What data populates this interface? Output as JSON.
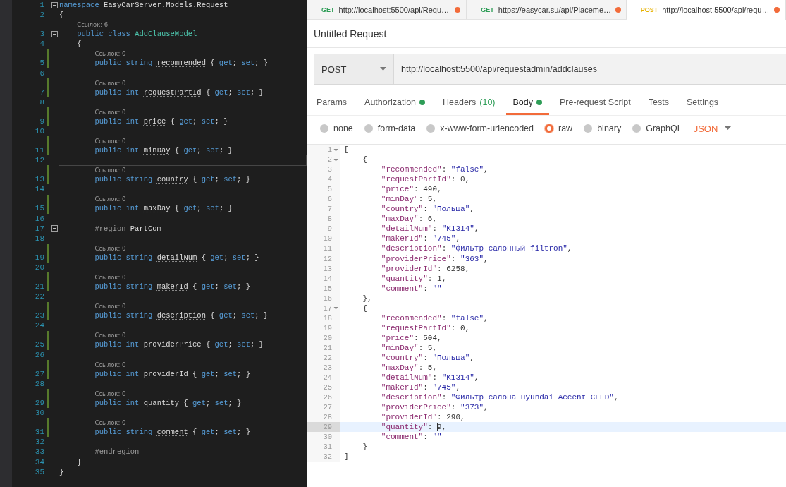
{
  "code_editor": {
    "lines": [
      {
        "num": "1",
        "fold": true,
        "changed": false,
        "current": false,
        "tokens": [
          {
            "kind": "kw",
            "text": "namespace"
          },
          {
            "kind": "text",
            "text": " EasyCarServer.Models.Request"
          }
        ]
      },
      {
        "num": "2",
        "fold": false,
        "changed": false,
        "current": false,
        "tokens": [
          {
            "kind": "text",
            "text": "{"
          }
        ]
      },
      {
        "num": "3",
        "lens": "Ссылок: 6",
        "fold": true,
        "changed": false,
        "current": false,
        "tokens": [
          {
            "kind": "kw",
            "text": "    public class "
          },
          {
            "kind": "type",
            "text": "AddClauseModel"
          }
        ]
      },
      {
        "num": "4",
        "fold": false,
        "changed": false,
        "current": false,
        "tokens": [
          {
            "kind": "text",
            "text": "    {"
          }
        ]
      },
      {
        "num": "5",
        "lens": "Ссылок: 0",
        "fold": false,
        "changed": true,
        "current": false,
        "tokens": [
          {
            "kind": "kw",
            "text": "        public string "
          },
          {
            "kind": "member",
            "text": "recommended"
          },
          {
            "kind": "text",
            "text": " { "
          },
          {
            "kind": "kw",
            "text": "get"
          },
          {
            "kind": "text",
            "text": "; "
          },
          {
            "kind": "kw",
            "text": "set"
          },
          {
            "kind": "text",
            "text": "; }"
          }
        ]
      },
      {
        "num": "6",
        "fold": false,
        "changed": false,
        "current": false
      },
      {
        "num": "7",
        "lens": "Ссылок: 0",
        "fold": false,
        "changed": true,
        "current": false,
        "tokens": [
          {
            "kind": "kw",
            "text": "        public int "
          },
          {
            "kind": "member",
            "text": "requestPartId"
          },
          {
            "kind": "text",
            "text": " { "
          },
          {
            "kind": "kw",
            "text": "get"
          },
          {
            "kind": "text",
            "text": "; "
          },
          {
            "kind": "kw",
            "text": "set"
          },
          {
            "kind": "text",
            "text": "; }"
          }
        ]
      },
      {
        "num": "8",
        "fold": false,
        "changed": false,
        "current": false
      },
      {
        "num": "9",
        "lens": "Ссылок: 0",
        "fold": false,
        "changed": true,
        "current": false,
        "tokens": [
          {
            "kind": "kw",
            "text": "        public int "
          },
          {
            "kind": "member",
            "text": "price"
          },
          {
            "kind": "text",
            "text": " { "
          },
          {
            "kind": "kw",
            "text": "get"
          },
          {
            "kind": "text",
            "text": "; "
          },
          {
            "kind": "kw",
            "text": "set"
          },
          {
            "kind": "text",
            "text": "; }"
          }
        ]
      },
      {
        "num": "10",
        "fold": false,
        "changed": false,
        "current": false
      },
      {
        "num": "11",
        "lens": "Ссылок: 0",
        "fold": false,
        "changed": true,
        "current": false,
        "tokens": [
          {
            "kind": "kw",
            "text": "        public int "
          },
          {
            "kind": "member",
            "text": "minDay"
          },
          {
            "kind": "text",
            "text": " { "
          },
          {
            "kind": "kw",
            "text": "get"
          },
          {
            "kind": "text",
            "text": "; "
          },
          {
            "kind": "kw",
            "text": "set"
          },
          {
            "kind": "text",
            "text": "; }"
          }
        ]
      },
      {
        "num": "12",
        "fold": false,
        "changed": false,
        "current": true
      },
      {
        "num": "13",
        "lens": "Ссылок: 0",
        "fold": false,
        "changed": true,
        "current": false,
        "tokens": [
          {
            "kind": "kw",
            "text": "        public string "
          },
          {
            "kind": "member",
            "text": "country"
          },
          {
            "kind": "text",
            "text": " { "
          },
          {
            "kind": "kw",
            "text": "get"
          },
          {
            "kind": "text",
            "text": "; "
          },
          {
            "kind": "kw",
            "text": "set"
          },
          {
            "kind": "text",
            "text": "; }"
          }
        ]
      },
      {
        "num": "14",
        "fold": false,
        "changed": false,
        "current": false
      },
      {
        "num": "15",
        "lens": "Ссылок: 0",
        "fold": false,
        "changed": true,
        "current": false,
        "tokens": [
          {
            "kind": "kw",
            "text": "        public int "
          },
          {
            "kind": "member",
            "text": "maxDay"
          },
          {
            "kind": "text",
            "text": " { "
          },
          {
            "kind": "kw",
            "text": "get"
          },
          {
            "kind": "text",
            "text": "; "
          },
          {
            "kind": "kw",
            "text": "set"
          },
          {
            "kind": "text",
            "text": "; }"
          }
        ]
      },
      {
        "num": "16",
        "fold": false,
        "changed": false,
        "current": false
      },
      {
        "num": "17",
        "fold": true,
        "changed": false,
        "current": false,
        "tokens": [
          {
            "kind": "directive",
            "text": "        #region"
          },
          {
            "kind": "text",
            "text": " PartCom"
          }
        ]
      },
      {
        "num": "18",
        "fold": false,
        "changed": false,
        "current": false
      },
      {
        "num": "19",
        "lens": "Ссылок: 0",
        "fold": false,
        "changed": true,
        "current": false,
        "tokens": [
          {
            "kind": "kw",
            "text": "        public string "
          },
          {
            "kind": "member",
            "text": "detailNum"
          },
          {
            "kind": "text",
            "text": " { "
          },
          {
            "kind": "kw",
            "text": "get"
          },
          {
            "kind": "text",
            "text": "; "
          },
          {
            "kind": "kw",
            "text": "set"
          },
          {
            "kind": "text",
            "text": "; }"
          }
        ]
      },
      {
        "num": "20",
        "fold": false,
        "changed": false,
        "current": false
      },
      {
        "num": "21",
        "lens": "Ссылок: 0",
        "fold": false,
        "changed": true,
        "current": false,
        "tokens": [
          {
            "kind": "kw",
            "text": "        public string "
          },
          {
            "kind": "member",
            "text": "makerId"
          },
          {
            "kind": "text",
            "text": " { "
          },
          {
            "kind": "kw",
            "text": "get"
          },
          {
            "kind": "text",
            "text": "; "
          },
          {
            "kind": "kw",
            "text": "set"
          },
          {
            "kind": "text",
            "text": "; }"
          }
        ]
      },
      {
        "num": "22",
        "fold": false,
        "changed": false,
        "current": false
      },
      {
        "num": "23",
        "lens": "Ссылок: 0",
        "fold": false,
        "changed": true,
        "current": false,
        "tokens": [
          {
            "kind": "kw",
            "text": "        public string "
          },
          {
            "kind": "member",
            "text": "description"
          },
          {
            "kind": "text",
            "text": " { "
          },
          {
            "kind": "kw",
            "text": "get"
          },
          {
            "kind": "text",
            "text": "; "
          },
          {
            "kind": "kw",
            "text": "set"
          },
          {
            "kind": "text",
            "text": "; }"
          }
        ]
      },
      {
        "num": "24",
        "fold": false,
        "changed": false,
        "current": false
      },
      {
        "num": "25",
        "lens": "Ссылок: 0",
        "fold": false,
        "changed": true,
        "current": false,
        "tokens": [
          {
            "kind": "kw",
            "text": "        public int "
          },
          {
            "kind": "member",
            "text": "providerPrice"
          },
          {
            "kind": "text",
            "text": " { "
          },
          {
            "kind": "kw",
            "text": "get"
          },
          {
            "kind": "text",
            "text": "; "
          },
          {
            "kind": "kw",
            "text": "set"
          },
          {
            "kind": "text",
            "text": "; }"
          }
        ]
      },
      {
        "num": "26",
        "fold": false,
        "changed": false,
        "current": false
      },
      {
        "num": "27",
        "lens": "Ссылок: 0",
        "fold": false,
        "changed": true,
        "current": false,
        "tokens": [
          {
            "kind": "kw",
            "text": "        public int "
          },
          {
            "kind": "member",
            "text": "providerId"
          },
          {
            "kind": "text",
            "text": " { "
          },
          {
            "kind": "kw",
            "text": "get"
          },
          {
            "kind": "text",
            "text": "; "
          },
          {
            "kind": "kw",
            "text": "set"
          },
          {
            "kind": "text",
            "text": "; }"
          }
        ]
      },
      {
        "num": "28",
        "fold": false,
        "changed": false,
        "current": false
      },
      {
        "num": "29",
        "lens": "Ссылок: 0",
        "fold": false,
        "changed": true,
        "current": false,
        "tokens": [
          {
            "kind": "kw",
            "text": "        public int "
          },
          {
            "kind": "member",
            "text": "quantity"
          },
          {
            "kind": "text",
            "text": " { "
          },
          {
            "kind": "kw",
            "text": "get"
          },
          {
            "kind": "text",
            "text": "; "
          },
          {
            "kind": "kw",
            "text": "set"
          },
          {
            "kind": "text",
            "text": "; }"
          }
        ]
      },
      {
        "num": "30",
        "fold": false,
        "changed": false,
        "current": false
      },
      {
        "num": "31",
        "lens": "Ссылок: 0",
        "fold": false,
        "changed": true,
        "current": false,
        "tokens": [
          {
            "kind": "kw",
            "text": "        public string "
          },
          {
            "kind": "member",
            "text": "comment"
          },
          {
            "kind": "text",
            "text": " { "
          },
          {
            "kind": "kw",
            "text": "get"
          },
          {
            "kind": "text",
            "text": "; "
          },
          {
            "kind": "kw",
            "text": "set"
          },
          {
            "kind": "text",
            "text": "; }"
          }
        ]
      },
      {
        "num": "32",
        "fold": false,
        "changed": false,
        "current": false
      },
      {
        "num": "33",
        "fold": false,
        "changed": false,
        "current": false,
        "tokens": [
          {
            "kind": "directive",
            "text": "        #endregion"
          }
        ]
      },
      {
        "num": "34",
        "fold": false,
        "changed": false,
        "current": false,
        "tokens": [
          {
            "kind": "text",
            "text": "    }"
          }
        ]
      },
      {
        "num": "35",
        "fold": false,
        "changed": false,
        "current": false,
        "tokens": [
          {
            "kind": "text",
            "text": "}"
          }
        ]
      }
    ]
  },
  "request_tabs": [
    {
      "method": "GET",
      "url": "http://localhost:5500/api/Requ…",
      "unsaved": true,
      "selected": false
    },
    {
      "method": "GET",
      "url": "https://easycar.su/api/Placeme…",
      "unsaved": true,
      "selected": false
    },
    {
      "method": "POST",
      "url": "http://localhost:5500/api/requ…",
      "unsaved": true,
      "selected": true
    }
  ],
  "request_title": "Untitled Request",
  "url_bar": {
    "method": "POST",
    "url": "http://localhost:5500/api/requestadmin/addclauses"
  },
  "section_tabs": [
    {
      "label": "Params",
      "indicator": false,
      "selected": false
    },
    {
      "label": "Authorization",
      "indicator": true,
      "selected": false
    },
    {
      "label": "Headers",
      "count": "(10)",
      "indicator": false,
      "selected": false
    },
    {
      "label": "Body",
      "indicator": true,
      "selected": true
    },
    {
      "label": "Pre-request Script",
      "indicator": false,
      "selected": false
    },
    {
      "label": "Tests",
      "indicator": false,
      "selected": false
    },
    {
      "label": "Settings",
      "indicator": false,
      "selected": false
    }
  ],
  "body_modes": [
    {
      "label": "none",
      "selected": false
    },
    {
      "label": "form-data",
      "selected": false
    },
    {
      "label": "x-www-form-urlencoded",
      "selected": false
    },
    {
      "label": "raw",
      "selected": true
    },
    {
      "label": "binary",
      "selected": false
    },
    {
      "label": "GraphQL",
      "selected": false
    }
  ],
  "body_format": "JSON",
  "body_editor": {
    "lines": [
      {
        "num": "1",
        "fold": true,
        "current": false,
        "tokens": [
          {
            "kind": "p",
            "text": "["
          }
        ]
      },
      {
        "num": "2",
        "fold": true,
        "current": false,
        "tokens": [
          {
            "kind": "p",
            "text": "    {"
          }
        ]
      },
      {
        "num": "3",
        "fold": false,
        "current": false,
        "tokens": [
          {
            "kind": "key",
            "text": "        \"recommended\""
          },
          {
            "kind": "p",
            "text": ": "
          },
          {
            "kind": "str",
            "text": "\"false\""
          },
          {
            "kind": "p",
            "text": ","
          }
        ]
      },
      {
        "num": "4",
        "fold": false,
        "current": false,
        "tokens": [
          {
            "kind": "key",
            "text": "        \"requestPartId\""
          },
          {
            "kind": "p",
            "text": ": "
          },
          {
            "kind": "num",
            "text": "0"
          },
          {
            "kind": "p",
            "text": ","
          }
        ]
      },
      {
        "num": "5",
        "fold": false,
        "current": false,
        "tokens": [
          {
            "kind": "key",
            "text": "        \"price\""
          },
          {
            "kind": "p",
            "text": ": "
          },
          {
            "kind": "num",
            "text": "490"
          },
          {
            "kind": "p",
            "text": ","
          }
        ]
      },
      {
        "num": "6",
        "fold": false,
        "current": false,
        "tokens": [
          {
            "kind": "key",
            "text": "        \"minDay\""
          },
          {
            "kind": "p",
            "text": ": "
          },
          {
            "kind": "num",
            "text": "5"
          },
          {
            "kind": "p",
            "text": ","
          }
        ]
      },
      {
        "num": "7",
        "fold": false,
        "current": false,
        "tokens": [
          {
            "kind": "key",
            "text": "        \"country\""
          },
          {
            "kind": "p",
            "text": ": "
          },
          {
            "kind": "str",
            "text": "\"Польша\""
          },
          {
            "kind": "p",
            "text": ","
          }
        ]
      },
      {
        "num": "8",
        "fold": false,
        "current": false,
        "tokens": [
          {
            "kind": "key",
            "text": "        \"maxDay\""
          },
          {
            "kind": "p",
            "text": ": "
          },
          {
            "kind": "num",
            "text": "6"
          },
          {
            "kind": "p",
            "text": ","
          }
        ]
      },
      {
        "num": "9",
        "fold": false,
        "current": false,
        "tokens": [
          {
            "kind": "key",
            "text": "        \"detailNum\""
          },
          {
            "kind": "p",
            "text": ": "
          },
          {
            "kind": "str",
            "text": "\"K1314\""
          },
          {
            "kind": "p",
            "text": ","
          }
        ]
      },
      {
        "num": "10",
        "fold": false,
        "current": false,
        "tokens": [
          {
            "kind": "key",
            "text": "        \"makerId\""
          },
          {
            "kind": "p",
            "text": ": "
          },
          {
            "kind": "str",
            "text": "\"745\""
          },
          {
            "kind": "p",
            "text": ","
          }
        ]
      },
      {
        "num": "11",
        "fold": false,
        "current": false,
        "tokens": [
          {
            "kind": "key",
            "text": "        \"description\""
          },
          {
            "kind": "p",
            "text": ": "
          },
          {
            "kind": "str",
            "text": "\"фильтр салонный filtron\""
          },
          {
            "kind": "p",
            "text": ","
          }
        ]
      },
      {
        "num": "12",
        "fold": false,
        "current": false,
        "tokens": [
          {
            "kind": "key",
            "text": "        \"providerPrice\""
          },
          {
            "kind": "p",
            "text": ": "
          },
          {
            "kind": "str",
            "text": "\"363\""
          },
          {
            "kind": "p",
            "text": ","
          }
        ]
      },
      {
        "num": "13",
        "fold": false,
        "current": false,
        "tokens": [
          {
            "kind": "key",
            "text": "        \"providerId\""
          },
          {
            "kind": "p",
            "text": ": "
          },
          {
            "kind": "num",
            "text": "6258"
          },
          {
            "kind": "p",
            "text": ","
          }
        ]
      },
      {
        "num": "14",
        "fold": false,
        "current": false,
        "tokens": [
          {
            "kind": "key",
            "text": "        \"quantity\""
          },
          {
            "kind": "p",
            "text": ": "
          },
          {
            "kind": "num",
            "text": "1"
          },
          {
            "kind": "p",
            "text": ","
          }
        ]
      },
      {
        "num": "15",
        "fold": false,
        "current": false,
        "tokens": [
          {
            "kind": "key",
            "text": "        \"comment\""
          },
          {
            "kind": "p",
            "text": ": "
          },
          {
            "kind": "str",
            "text": "\"\""
          }
        ]
      },
      {
        "num": "16",
        "fold": false,
        "current": false,
        "tokens": [
          {
            "kind": "p",
            "text": "    },"
          }
        ]
      },
      {
        "num": "17",
        "fold": true,
        "current": false,
        "tokens": [
          {
            "kind": "p",
            "text": "    {"
          }
        ]
      },
      {
        "num": "18",
        "fold": false,
        "current": false,
        "tokens": [
          {
            "kind": "key",
            "text": "        \"recommended\""
          },
          {
            "kind": "p",
            "text": ": "
          },
          {
            "kind": "str",
            "text": "\"false\""
          },
          {
            "kind": "p",
            "text": ","
          }
        ]
      },
      {
        "num": "19",
        "fold": false,
        "current": false,
        "tokens": [
          {
            "kind": "key",
            "text": "        \"requestPartId\""
          },
          {
            "kind": "p",
            "text": ": "
          },
          {
            "kind": "num",
            "text": "0"
          },
          {
            "kind": "p",
            "text": ","
          }
        ]
      },
      {
        "num": "20",
        "fold": false,
        "current": false,
        "tokens": [
          {
            "kind": "key",
            "text": "        \"price\""
          },
          {
            "kind": "p",
            "text": ": "
          },
          {
            "kind": "num",
            "text": "504"
          },
          {
            "kind": "p",
            "text": ","
          }
        ]
      },
      {
        "num": "21",
        "fold": false,
        "current": false,
        "tokens": [
          {
            "kind": "key",
            "text": "        \"minDay\""
          },
          {
            "kind": "p",
            "text": ": "
          },
          {
            "kind": "num",
            "text": "5"
          },
          {
            "kind": "p",
            "text": ","
          }
        ]
      },
      {
        "num": "22",
        "fold": false,
        "current": false,
        "tokens": [
          {
            "kind": "key",
            "text": "        \"country\""
          },
          {
            "kind": "p",
            "text": ": "
          },
          {
            "kind": "str",
            "text": "\"Польша\""
          },
          {
            "kind": "p",
            "text": ","
          }
        ]
      },
      {
        "num": "23",
        "fold": false,
        "current": false,
        "tokens": [
          {
            "kind": "key",
            "text": "        \"maxDay\""
          },
          {
            "kind": "p",
            "text": ": "
          },
          {
            "kind": "num",
            "text": "5"
          },
          {
            "kind": "p",
            "text": ","
          }
        ]
      },
      {
        "num": "24",
        "fold": false,
        "current": false,
        "tokens": [
          {
            "kind": "key",
            "text": "        \"detailNum\""
          },
          {
            "kind": "p",
            "text": ": "
          },
          {
            "kind": "str",
            "text": "\"K1314\""
          },
          {
            "kind": "p",
            "text": ","
          }
        ]
      },
      {
        "num": "25",
        "fold": false,
        "current": false,
        "tokens": [
          {
            "kind": "key",
            "text": "        \"makerId\""
          },
          {
            "kind": "p",
            "text": ": "
          },
          {
            "kind": "str",
            "text": "\"745\""
          },
          {
            "kind": "p",
            "text": ","
          }
        ]
      },
      {
        "num": "26",
        "fold": false,
        "current": false,
        "tokens": [
          {
            "kind": "key",
            "text": "        \"description\""
          },
          {
            "kind": "p",
            "text": ": "
          },
          {
            "kind": "str",
            "text": "\"Фильтр салона Hyundai Accent CEED\""
          },
          {
            "kind": "p",
            "text": ","
          }
        ]
      },
      {
        "num": "27",
        "fold": false,
        "current": false,
        "tokens": [
          {
            "kind": "key",
            "text": "        \"providerPrice\""
          },
          {
            "kind": "p",
            "text": ": "
          },
          {
            "kind": "str",
            "text": "\"373\""
          },
          {
            "kind": "p",
            "text": ","
          }
        ]
      },
      {
        "num": "28",
        "fold": false,
        "current": false,
        "tokens": [
          {
            "kind": "key",
            "text": "        \"providerId\""
          },
          {
            "kind": "p",
            "text": ": "
          },
          {
            "kind": "num",
            "text": "290"
          },
          {
            "kind": "p",
            "text": ","
          }
        ]
      },
      {
        "num": "29",
        "fold": false,
        "current": true,
        "tokens": [
          {
            "kind": "key",
            "text": "        \"quantity\""
          },
          {
            "kind": "p",
            "text": ": "
          },
          {
            "kind": "num",
            "text": "9"
          },
          {
            "kind": "p",
            "text": ","
          }
        ]
      },
      {
        "num": "30",
        "fold": false,
        "current": false,
        "tokens": [
          {
            "kind": "key",
            "text": "        \"comment\""
          },
          {
            "kind": "p",
            "text": ": "
          },
          {
            "kind": "str",
            "text": "\"\""
          }
        ]
      },
      {
        "num": "31",
        "fold": false,
        "current": false,
        "tokens": [
          {
            "kind": "p",
            "text": "    }"
          }
        ]
      },
      {
        "num": "32",
        "fold": false,
        "current": false,
        "tokens": [
          {
            "kind": "p",
            "text": "]"
          }
        ]
      }
    ]
  }
}
